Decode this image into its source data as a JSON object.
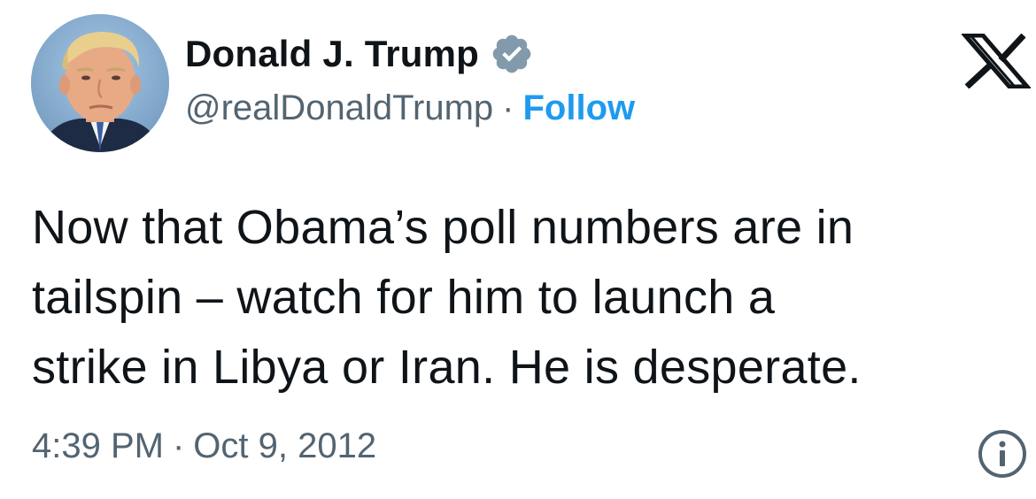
{
  "author": {
    "display_name": "Donald J. Trump",
    "handle": "@realDonaldTrump",
    "verified": true,
    "verified_badge_color": "#829aab"
  },
  "header": {
    "separator": "·",
    "follow_label": "Follow",
    "follow_color": "#1d9bf0",
    "platform_logo": "x-logo-icon"
  },
  "tweet": {
    "text": "Now that Obama’s poll numbers are in\ntailspin – watch for him to launch a\nstrike in Libya or Iran.  He is desperate."
  },
  "meta": {
    "time": "4:39 PM",
    "separator": "·",
    "date": "Oct 9, 2012",
    "info_icon": "info-circle-icon"
  },
  "colors": {
    "text_primary": "#0f1419",
    "text_secondary": "#536471",
    "background": "#ffffff"
  }
}
